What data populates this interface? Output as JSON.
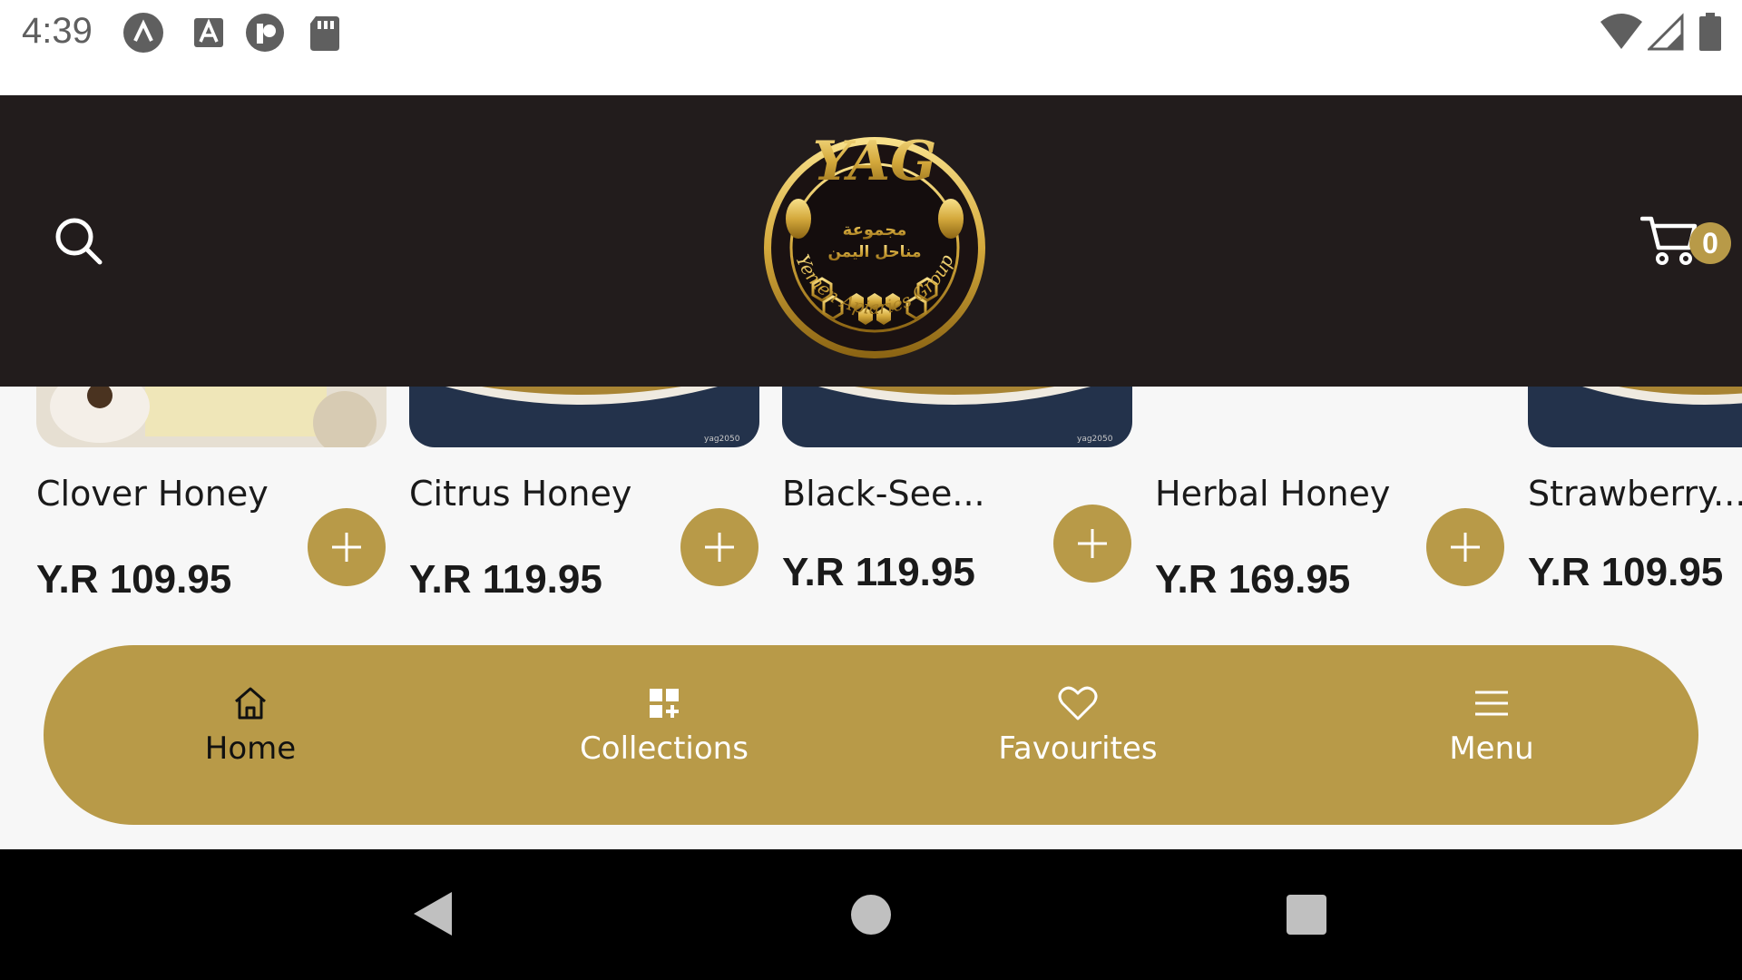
{
  "status_bar": {
    "time": "4:39",
    "left_icons": [
      "app-a-icon",
      "keyboard-a-icon",
      "app-r-icon",
      "sd-card-icon"
    ],
    "right_icons": [
      "wifi-icon",
      "signal-icon",
      "battery-icon"
    ]
  },
  "header": {
    "logo": {
      "text_top": "YAG",
      "arabic_line1": "مجموعة",
      "arabic_line2": "مناحل اليمن",
      "ring_text": "Yemen Apiaries Group"
    },
    "cart_count": "0",
    "colors": {
      "background": "#221c1c",
      "accent": "#b89a48"
    }
  },
  "products": [
    {
      "name": "Clover Honey",
      "price": "Y.R 109.95"
    },
    {
      "name": "Citrus Honey",
      "price": "Y.R 119.95"
    },
    {
      "name": "Black-See...",
      "price": "Y.R 119.95"
    },
    {
      "name": "Herbal Honey",
      "price": "Y.R 169.95"
    },
    {
      "name": "Strawberry...",
      "price": "Y.R 109.95"
    }
  ],
  "image_watermark": "yag2050",
  "bottom_nav": {
    "items": [
      {
        "label": "Home",
        "icon": "home-icon",
        "active": true
      },
      {
        "label": "Collections",
        "icon": "grid-add-icon",
        "active": false
      },
      {
        "label": "Favourites",
        "icon": "heart-icon",
        "active": false
      },
      {
        "label": "Menu",
        "icon": "hamburger-menu-icon",
        "active": false
      }
    ]
  },
  "android_nav": [
    "back-icon",
    "home-circle-icon",
    "recents-icon"
  ]
}
